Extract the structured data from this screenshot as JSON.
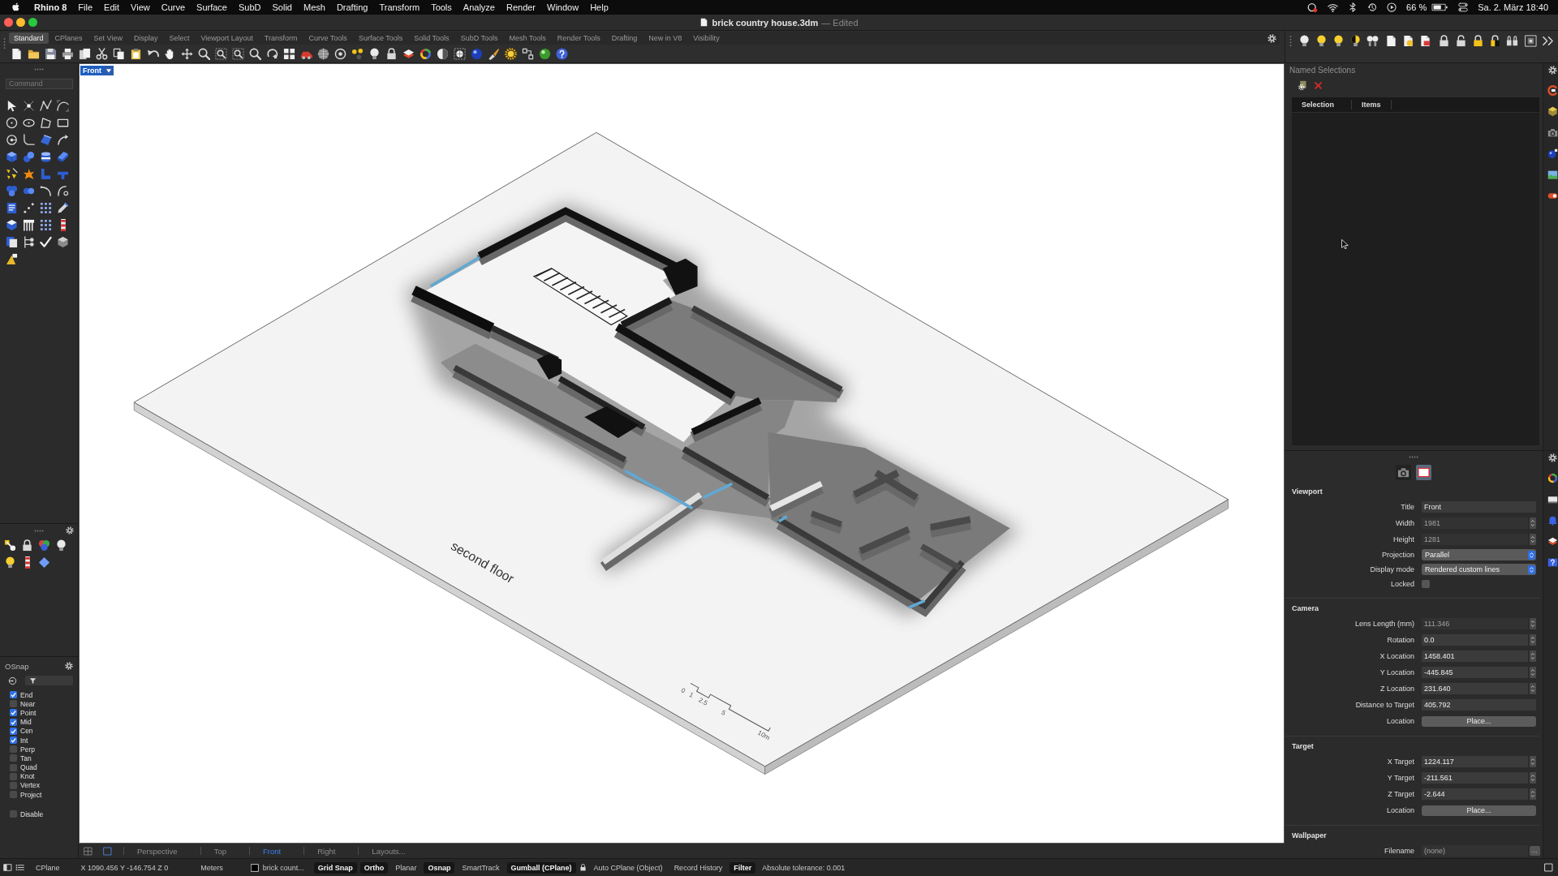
{
  "menu_bar": {
    "app_name": "Rhino 8",
    "menus": [
      "File",
      "Edit",
      "View",
      "Curve",
      "Surface",
      "SubD",
      "Solid",
      "Mesh",
      "Drafting",
      "Transform",
      "Tools",
      "Analyze",
      "Render",
      "Window",
      "Help"
    ],
    "battery": "66 %",
    "clock": "Sa. 2. März 18:40"
  },
  "window": {
    "title": "brick country house.3dm",
    "state": "— Edited"
  },
  "toolbar_tabs": [
    {
      "label": "Standard",
      "selected": true
    },
    {
      "label": "CPlanes",
      "selected": false
    },
    {
      "label": "Set View",
      "selected": false
    },
    {
      "label": "Display",
      "selected": false
    },
    {
      "label": "Select",
      "selected": false
    },
    {
      "label": "Viewport Layout",
      "selected": false
    },
    {
      "label": "Transform",
      "selected": false
    },
    {
      "label": "Curve Tools",
      "selected": false
    },
    {
      "label": "Surface Tools",
      "selected": false
    },
    {
      "label": "Solid Tools",
      "selected": false
    },
    {
      "label": "SubD Tools",
      "selected": false
    },
    {
      "label": "Mesh Tools",
      "selected": false
    },
    {
      "label": "Render Tools",
      "selected": false
    },
    {
      "label": "Drafting",
      "selected": false
    },
    {
      "label": "New in V8",
      "selected": false
    },
    {
      "label": "Visibility",
      "selected": false
    }
  ],
  "command": {
    "placeholder": "Command"
  },
  "osnap": {
    "title": "OSnap",
    "items": [
      {
        "label": "End",
        "checked": true
      },
      {
        "label": "Near",
        "checked": false
      },
      {
        "label": "Point",
        "checked": true
      },
      {
        "label": "Mid",
        "checked": true
      },
      {
        "label": "Cen",
        "checked": true
      },
      {
        "label": "Int",
        "checked": true
      },
      {
        "label": "Perp",
        "checked": false
      },
      {
        "label": "Tan",
        "checked": false
      },
      {
        "label": "Quad",
        "checked": false
      },
      {
        "label": "Knot",
        "checked": false
      },
      {
        "label": "Vertex",
        "checked": false
      },
      {
        "label": "Project",
        "checked": false
      }
    ],
    "disable": {
      "label": "Disable",
      "checked": false
    }
  },
  "viewport": {
    "title": "Front",
    "floor_label": "second floor",
    "scale_labels": [
      "0",
      "1",
      "2.5",
      "5",
      "10m"
    ]
  },
  "viewport_tabs": [
    {
      "label": "Perspective",
      "selected": false
    },
    {
      "label": "Top",
      "selected": false
    },
    {
      "label": "Front",
      "selected": true
    },
    {
      "label": "Right",
      "selected": false
    }
  ],
  "layouts_button": "Layouts...",
  "named_selections": {
    "title": "Named Selections",
    "columns": [
      "Selection",
      "Items"
    ]
  },
  "properties": {
    "sections": [
      {
        "title": "Viewport",
        "rows": [
          {
            "label": "Title",
            "kind": "text",
            "value": "Front",
            "disabled": false
          },
          {
            "label": "Width",
            "kind": "spin",
            "value": "1981",
            "disabled": true
          },
          {
            "label": "Height",
            "kind": "spin",
            "value": "1281",
            "disabled": true
          },
          {
            "label": "Projection",
            "kind": "select",
            "value": "Parallel",
            "disabled": false
          },
          {
            "label": "Display mode",
            "kind": "select",
            "value": "Rendered custom lines",
            "disabled": false
          },
          {
            "label": "Locked",
            "kind": "checkbox",
            "checked": false,
            "disabled": false
          }
        ]
      },
      {
        "title": "Camera",
        "rows": [
          {
            "label": "Lens Length (mm)",
            "kind": "spin",
            "value": "111.346",
            "disabled": true
          },
          {
            "label": "Rotation",
            "kind": "spin",
            "value": "0.0",
            "disabled": false
          },
          {
            "label": "X Location",
            "kind": "spin",
            "value": "1458.401",
            "disabled": false
          },
          {
            "label": "Y Location",
            "kind": "spin",
            "value": "-445.845",
            "disabled": false
          },
          {
            "label": "Z Location",
            "kind": "spin",
            "value": "231.640",
            "disabled": false
          },
          {
            "label": "Distance to Target",
            "kind": "text",
            "value": "405.792",
            "disabled": false
          },
          {
            "label": "Location",
            "kind": "button",
            "value": "Place...",
            "disabled": false
          }
        ]
      },
      {
        "title": "Target",
        "rows": [
          {
            "label": "X Target",
            "kind": "spin",
            "value": "1224.117",
            "disabled": false
          },
          {
            "label": "Y Target",
            "kind": "spin",
            "value": "-211.561",
            "disabled": false
          },
          {
            "label": "Z Target",
            "kind": "spin",
            "value": "-2.644",
            "disabled": false
          },
          {
            "label": "Location",
            "kind": "button",
            "value": "Place...",
            "disabled": false
          }
        ]
      },
      {
        "title": "Wallpaper",
        "rows": [
          {
            "label": "Filename",
            "kind": "file",
            "value": "(none)",
            "button": "...",
            "disabled": true
          }
        ]
      }
    ]
  },
  "status_bar": {
    "cplane": "CPlane",
    "coordinates": "X 1090.456 Y -146.754 Z 0",
    "units": "Meters",
    "layer": "brick count...",
    "toggles": [
      {
        "label": "Grid Snap",
        "kind": "toggle",
        "on": true
      },
      {
        "label": "Ortho",
        "kind": "toggle",
        "on": true
      },
      {
        "label": "Planar",
        "kind": "toggle",
        "on": false
      },
      {
        "label": "Osnap",
        "kind": "toggle",
        "on": true
      },
      {
        "label": "SmartTrack",
        "kind": "toggle",
        "on": false
      },
      {
        "label": "Gumball (CPlane)",
        "kind": "toggle",
        "on": true
      },
      {
        "label": "Auto CPlane (Object)",
        "kind": "lock-toggle",
        "on": false
      },
      {
        "label": "Record History",
        "kind": "toggle",
        "on": false
      },
      {
        "label": "Filter",
        "kind": "toggle",
        "on": true
      }
    ],
    "tolerance": "Absolute tolerance: 0.001"
  }
}
